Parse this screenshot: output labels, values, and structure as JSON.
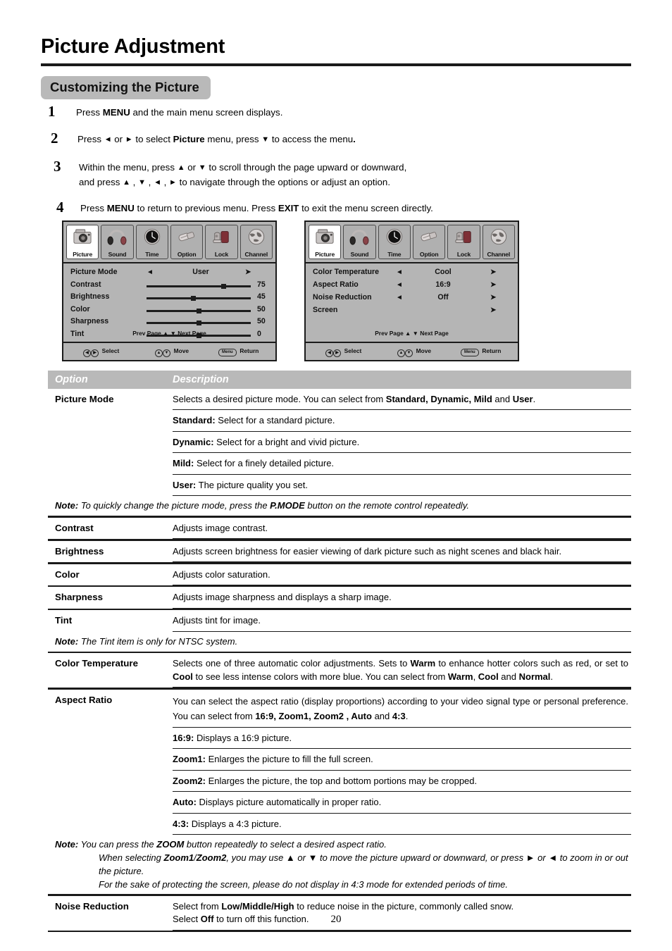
{
  "document": {
    "title": "Picture Adjustment",
    "section_heading": "Customizing the Picture",
    "page_number": "20"
  },
  "steps": [
    {
      "num": "1",
      "lines": [
        [
          {
            "t": "Press ",
            "b": false
          },
          {
            "t": "MENU",
            "b": true
          },
          {
            "t": " and the main menu screen displays.",
            "b": false
          }
        ]
      ]
    },
    {
      "num": "2",
      "lines": [
        [
          {
            "t": "Press ",
            "b": false
          },
          {
            "t": "◄",
            "b": false,
            "arrow": true
          },
          {
            "t": " or ",
            "b": false
          },
          {
            "t": "►",
            "b": false,
            "arrow": true
          },
          {
            "t": " to select ",
            "b": false
          },
          {
            "t": "Picture",
            "b": true
          },
          {
            "t": " menu,  press ",
            "b": false
          },
          {
            "t": "▼",
            "b": false,
            "arrow": true
          },
          {
            "t": " to access the menu",
            "b": false
          },
          {
            "t": ".",
            "b": true
          }
        ]
      ]
    },
    {
      "num": "3",
      "lines": [
        [
          {
            "t": "Within the menu, press ",
            "b": false
          },
          {
            "t": "▲",
            "b": false,
            "arrow": true
          },
          {
            "t": " or ",
            "b": false
          },
          {
            "t": "▼",
            "b": false,
            "arrow": true
          },
          {
            "t": " to scroll through the page upward or downward,",
            "b": false
          }
        ],
        [
          {
            "t": "and press ",
            "b": false
          },
          {
            "t": "▲",
            "b": false,
            "arrow": true
          },
          {
            "t": " , ",
            "b": false
          },
          {
            "t": "▼",
            "b": false,
            "arrow": true
          },
          {
            "t": " , ",
            "b": false
          },
          {
            "t": "◄",
            "b": false,
            "arrow": true
          },
          {
            "t": " , ",
            "b": false
          },
          {
            "t": "►",
            "b": false,
            "arrow": true
          },
          {
            "t": " to navigate through the options or adjust an option.",
            "b": false
          }
        ]
      ]
    },
    {
      "num": "4",
      "lines": [
        [
          {
            "t": "Press ",
            "b": false
          },
          {
            "t": "MENU",
            "b": true
          },
          {
            "t": " to return to previous menu. Press ",
            "b": false
          },
          {
            "t": "EXIT",
            "b": true
          },
          {
            "t": " to exit the menu screen directly.",
            "b": false
          }
        ]
      ]
    }
  ],
  "osd": {
    "tabs": [
      {
        "label": "Picture",
        "icon": "camera-icon",
        "active": true
      },
      {
        "label": "Sound",
        "icon": "headphones-icon",
        "active": false
      },
      {
        "label": "Time",
        "icon": "clock-icon",
        "active": false
      },
      {
        "label": "Option",
        "icon": "connector-icon",
        "active": false
      },
      {
        "label": "Lock",
        "icon": "padlock-chair-icon",
        "active": false
      },
      {
        "label": "Channel",
        "icon": "globe-icon",
        "active": false
      }
    ],
    "pager": "Prev  Page ▲  ▼ Next  Page",
    "footer": {
      "select_keys": "◄/►",
      "select_label": "Select",
      "move_keys": "▲/▼",
      "move_label": "Move",
      "return_key": "Menu",
      "return_label": "Return"
    },
    "screen1": {
      "rows": [
        {
          "type": "choice",
          "name": "Picture Mode",
          "value": "User",
          "left": "◄",
          "right": "➤"
        },
        {
          "type": "slider",
          "name": "Contrast",
          "value": "75",
          "percent": 75
        },
        {
          "type": "slider",
          "name": "Brightness",
          "value": "45",
          "percent": 45
        },
        {
          "type": "slider",
          "name": "Color",
          "value": "50",
          "percent": 50
        },
        {
          "type": "slider",
          "name": "Sharpness",
          "value": "50",
          "percent": 50
        },
        {
          "type": "slider",
          "name": "Tint",
          "value": "0",
          "percent": 50
        }
      ]
    },
    "screen2": {
      "rows": [
        {
          "type": "choice",
          "name": "Color Temperature",
          "value": "Cool",
          "left": "◄",
          "right": "➤"
        },
        {
          "type": "choice",
          "name": "Aspect Ratio",
          "value": "16:9",
          "left": "◄",
          "right": "➤"
        },
        {
          "type": "choice",
          "name": "Noise Reduction",
          "value": "Off",
          "left": "◄",
          "right": "➤"
        },
        {
          "type": "arrow",
          "name": "Screen",
          "value": "",
          "left": "",
          "right": "➤"
        }
      ]
    }
  },
  "table": {
    "headers": {
      "option": "Option",
      "description": "Description"
    },
    "rows": [
      {
        "kind": "main",
        "option": "Picture Mode",
        "desc_html": "Selects a desired picture mode. You can select from <b>Standard, Dynamic, Mild</b> and <b>User</b>."
      },
      {
        "kind": "sub",
        "option": "",
        "desc_html": "<b>Standard:</b> Select for a standard picture."
      },
      {
        "kind": "sub",
        "option": "",
        "desc_html": "<b>Dynamic:</b> Select for a bright and vivid picture."
      },
      {
        "kind": "sub",
        "option": "",
        "desc_html": "<b>Mild:</b> Select for a finely detailed picture."
      },
      {
        "kind": "sub",
        "option": "",
        "desc_html": "<b>User:</b> The picture quality you set."
      },
      {
        "kind": "note",
        "desc_html": "<span class=\"nb\">Note:</span> To quickly change the picture mode, press the <span class=\"nb\">P.MODE</span> button on the remote control repeatedly."
      },
      {
        "kind": "main",
        "option": "Contrast",
        "desc_html": "Adjusts image contrast."
      },
      {
        "kind": "main",
        "option": "Brightness",
        "desc_html": "Adjusts screen brightness for easier viewing of dark picture such as night scenes and black hair."
      },
      {
        "kind": "main",
        "option": "Color",
        "desc_html": "Adjusts color saturation."
      },
      {
        "kind": "main",
        "option": "Sharpness",
        "desc_html": "Adjusts image sharpness and displays a sharp image."
      },
      {
        "kind": "main-nb",
        "option": "Tint",
        "desc_html": "Adjusts tint for image."
      },
      {
        "kind": "note",
        "desc_html": "<span class=\"nb\">Note:</span> The Tint item is only for NTSC system."
      },
      {
        "kind": "main",
        "option": "Color Temperature",
        "justify": true,
        "desc_html": "Selects one of three automatic color adjustments.  Sets to <b>Warm</b> to enhance hotter colors such as red,  or set to <b>Cool</b> to see less intense colors with more blue.  You can select from <b>Warm</b>, <b>Cool</b> and <b>Normal</b>."
      },
      {
        "kind": "main",
        "option": "Aspect Ratio",
        "justify": true,
        "wide": true,
        "desc_html": "You can select the aspect ratio (display proportions) according to your video signal type or personal preference. You can select from <b>16:9,  Zoom1, Zoom2 , Auto</b> and <b>4:3</b>."
      },
      {
        "kind": "sub",
        "option": "",
        "desc_html": "<b>16:9:</b> Displays a 16:9 picture."
      },
      {
        "kind": "sub",
        "option": "",
        "desc_html": "<b>Zoom1:</b> Enlarges the picture to fill the full screen."
      },
      {
        "kind": "sub",
        "option": "",
        "desc_html": "<b>Zoom2:</b> Enlarges the picture, the top and bottom portions may be cropped."
      },
      {
        "kind": "sub",
        "option": "",
        "desc_html": "<b>Auto:</b> Displays picture automatically in proper ratio."
      },
      {
        "kind": "sub",
        "option": "",
        "desc_html": "<b>4:3:</b> Displays a 4:3 picture."
      },
      {
        "kind": "note-multi",
        "lines_html": [
          "<span class=\"nb\">Note:</span> You can press the <span class=\"nb\">ZOOM</span> button repeatedly to select a desired aspect ratio.",
          "When selecting <span class=\"nb\">Zoom1</span>/<span class=\"nb\">Zoom2</span>, you may use ▲ or ▼ to move the picture upward or downward, or press ► or ◄ to zoom in or out the picture.",
          "For the sake of protecting the screen, please do not display in 4:3 mode for extended periods of time."
        ]
      },
      {
        "kind": "main-last",
        "option": "Noise Reduction",
        "desc_html": "Select from <b>Low/Middle/High</b> to reduce noise in the picture, commonly called snow.<br>Select <b>Off</b> to turn off this function."
      }
    ]
  }
}
